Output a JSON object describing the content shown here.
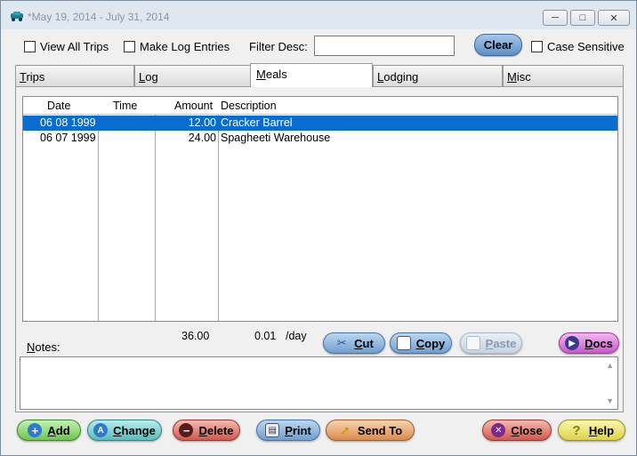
{
  "window": {
    "title": "*May 19, 2014 - July 31, 2014"
  },
  "toolbar": {
    "view_all_trips": "View All Trips",
    "make_log_entries": "Make Log Entries",
    "filter_label": "Filter Desc:",
    "filter_value": "",
    "clear": "Clear",
    "case_sensitive": "Case Sensitive"
  },
  "tabs": [
    {
      "first": "T",
      "rest": "rips"
    },
    {
      "first": "L",
      "rest": "og"
    },
    {
      "first": "M",
      "rest": "eals"
    },
    {
      "first": "L",
      "rest": "odging"
    },
    {
      "first": "M",
      "rest": "isc"
    }
  ],
  "columns": {
    "date": "Date",
    "time": "Time",
    "amount": "Amount",
    "description": "Description"
  },
  "rows": [
    {
      "date": "06 08 1999",
      "time": "",
      "amount": "12.00",
      "description": "Cracker Barrel"
    },
    {
      "date": "06 07 1999",
      "time": "",
      "amount": "24.00",
      "description": "Spagheeti Warehouse"
    }
  ],
  "totals": {
    "amount": "36.00",
    "per_day": "0.01",
    "per_day_unit": "/day"
  },
  "edit_buttons": {
    "cut_first": "C",
    "cut_rest": "ut",
    "copy_first": "C",
    "copy_rest": "opy",
    "paste_first": "P",
    "paste_rest": "aste",
    "docs_first": "D",
    "docs_rest": "ocs"
  },
  "notes": {
    "label_first": "N",
    "label_rest": "otes:",
    "value": ""
  },
  "bottom_buttons": {
    "add_first": "A",
    "add_rest": "dd",
    "change_first": "C",
    "change_rest": "hange",
    "delete_first": "D",
    "delete_rest": "elete",
    "print_first": "P",
    "print_rest": "rint",
    "send_to": "Send To",
    "close_first": "C",
    "close_rest": "lose",
    "help_first": "H",
    "help_rest": "elp"
  }
}
